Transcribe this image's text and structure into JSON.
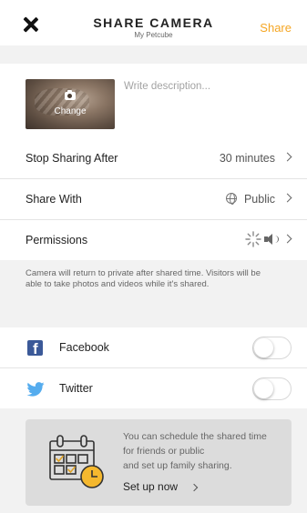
{
  "header": {
    "title": "SHARE CAMERA",
    "subtitle": "My Petcube",
    "share_label": "Share"
  },
  "description": {
    "change_label": "Change",
    "placeholder": "Write description...",
    "value": ""
  },
  "settings": {
    "stop_sharing": {
      "label": "Stop Sharing After",
      "value": "30 minutes"
    },
    "share_with": {
      "label": "Share With",
      "value": "Public"
    },
    "permissions": {
      "label": "Permissions"
    }
  },
  "note": "Camera will return to private after shared time. Visitors will be able to take photos and videos while it's shared.",
  "social": {
    "facebook": {
      "label": "Facebook",
      "enabled": false
    },
    "twitter": {
      "label": "Twitter",
      "enabled": false
    }
  },
  "promo": {
    "line1": "You can schedule the shared time",
    "line2": "for friends or public",
    "line3": "and set up family sharing.",
    "link": "Set up now"
  },
  "colors": {
    "accent": "#f5a623",
    "facebook": "#3b5998",
    "twitter": "#55acee"
  },
  "icons": [
    "close-icon",
    "camera-icon",
    "chevron-right-icon",
    "globe-icon",
    "sparkle-icon",
    "speaker-icon",
    "facebook-icon",
    "twitter-icon",
    "calendar-clock-icon"
  ]
}
